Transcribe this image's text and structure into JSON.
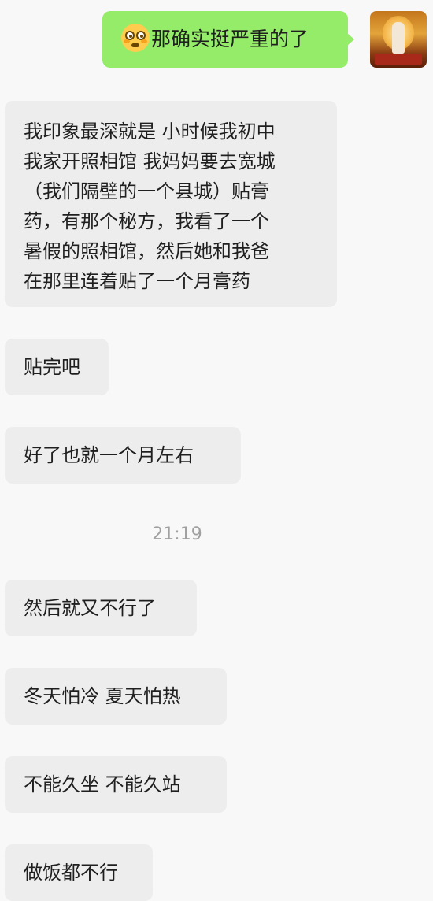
{
  "chat": {
    "outgoing": {
      "emoji": "flushed-face-emoji",
      "text": "那确实挺严重的了"
    },
    "incoming": [
      {
        "lines": [
          "我印象最深就是 小时候我初中",
          "我家开照相馆 我妈妈要去宽城",
          "（我们隔壁的一个县城）贴膏",
          "药，有那个秘方，我看了一个",
          "暑假的照相馆，然后她和我爸",
          "在那里连着贴了一个月膏药"
        ]
      },
      {
        "lines": [
          "贴完吧"
        ]
      },
      {
        "lines": [
          "好了也就一个月左右"
        ]
      },
      {
        "lines": [
          "然后就又不行了"
        ]
      },
      {
        "lines": [
          "冬天怕冷 夏天怕热"
        ]
      },
      {
        "lines": [
          "不能久坐 不能久站"
        ]
      },
      {
        "lines": [
          "做饭都不行"
        ]
      }
    ],
    "timestamp": "21:19"
  },
  "colors": {
    "background": "#f8f8f8",
    "incoming_bubble": "#ededed",
    "outgoing_bubble": "#95ec69",
    "timestamp": "#a0a0a0"
  }
}
